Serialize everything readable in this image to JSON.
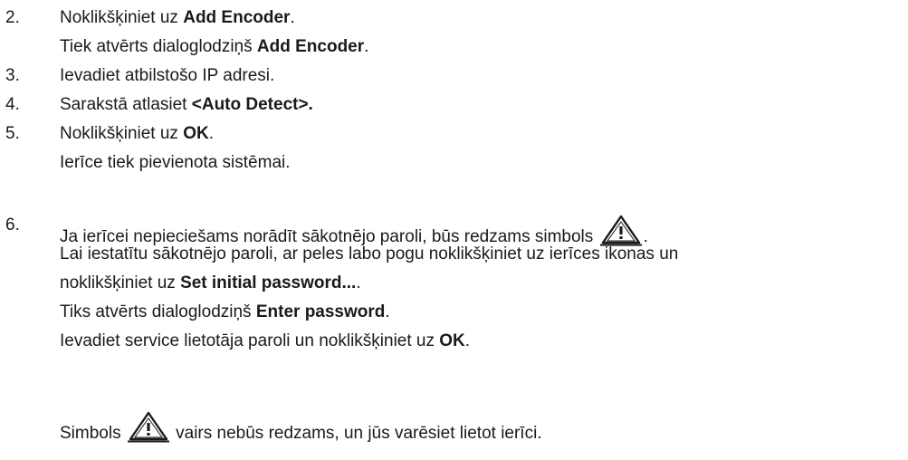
{
  "steps": [
    {
      "number": "2.",
      "text": "Noklikšķiniet uz ",
      "bold": "Add Encoder",
      "tail": ".",
      "result": {
        "text": "Tiek atvērts dialoglodziņš ",
        "bold": "Add Encoder",
        "tail": "."
      }
    },
    {
      "number": "3.",
      "text": "Ievadiet atbilstošo IP adresi."
    },
    {
      "number": "4.",
      "text": "Sarakstā atlasiet ",
      "bold": "<Auto Detect>."
    },
    {
      "number": "5.",
      "text": "Noklikšķiniet uz ",
      "bold": "OK",
      "tail": ".",
      "result": {
        "text": "Ierīce tiek pievienota sistēmai."
      }
    },
    {
      "number": "6.",
      "text": "Ja ierīcei nepieciešams norādīt sākotnējo paroli, būs redzams simbols ",
      "tail": ".",
      "sub": [
        {
          "text": "Lai iestatītu sākotnējo paroli, ar peles labo pogu noklikšķiniet uz ierīces ikonas un"
        },
        {
          "text": "noklikšķiniet uz ",
          "bold": "Set initial password...",
          "tail": "."
        },
        {
          "text": "Tiks atvērts dialoglodziņš ",
          "bold": "Enter password",
          "tail": "."
        },
        {
          "text": "Ievadiet service lietotāja paroli un noklikšķiniet uz ",
          "bold": "OK",
          "tail": "."
        }
      ],
      "final": {
        "text_before": "Simbols ",
        "text_after": " vairs nebūs redzams, un jūs varēsiet lietot ierīci."
      }
    }
  ],
  "icons": {
    "warning": "warning-triangle-icon"
  }
}
